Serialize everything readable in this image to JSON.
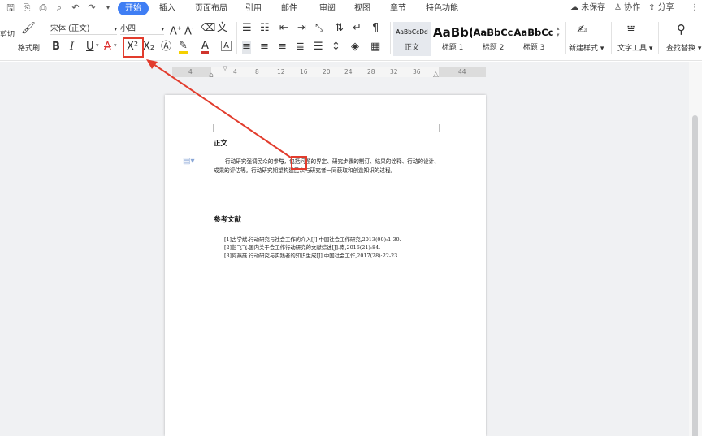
{
  "menubar": {
    "tabs": [
      "开始",
      "插入",
      "页面布局",
      "引用",
      "邮件",
      "审阅",
      "视图",
      "章节",
      "特色功能"
    ],
    "active_tab": "开始",
    "unsaved": "未保存",
    "collab": "协作",
    "share": "分享"
  },
  "ribbon": {
    "cut_label": "剪切",
    "format_painter": "格式刷",
    "font_name": "宋体 (正文)",
    "font_size": "小四",
    "bold": "B",
    "italic": "I",
    "underline": "U",
    "superscript": "X²",
    "subscript": "X₂",
    "styles": [
      {
        "sample": "AaBbCcDd",
        "name": "正文"
      },
      {
        "sample": "AaBb(",
        "name": "标题 1"
      },
      {
        "sample": "AaBbCc",
        "name": "标题 2"
      },
      {
        "sample": "AaBbCc",
        "name": "标题 3"
      }
    ],
    "new_style": "新建样式",
    "text_tools": "文字工具",
    "find_replace": "查找替换"
  },
  "ruler": {
    "numbers": [
      "4",
      "4",
      "8",
      "12",
      "16",
      "20",
      "24",
      "28",
      "32",
      "36",
      "44"
    ]
  },
  "document": {
    "heading1": "正文",
    "para1_before": "行动研究强调民众的参",
    "para1_marked": "与",
    "para1_after": "，包括问题的界定、研究步骤的制订、结果的诠释、行动的设计、成果的评估等。行动研究期望构建民众与研究者一同获取和创造知识的过程。",
    "heading2": "参考文献",
    "refs": [
      "[1]古学斌.行动研究与社会工作的介入[J].中国社会工作研究,2013(00):1-30.",
      "[2]彭飞飞.国内关于会工作行动研究的文献综述[J].南,2016(21):84.",
      "[3]何燕菇.行动研究与实践者的知识生成[J].中国社会工作,2017(28):22-23."
    ]
  },
  "colors": {
    "accent": "#3f7ef4",
    "annotation": "#e23c2d"
  }
}
